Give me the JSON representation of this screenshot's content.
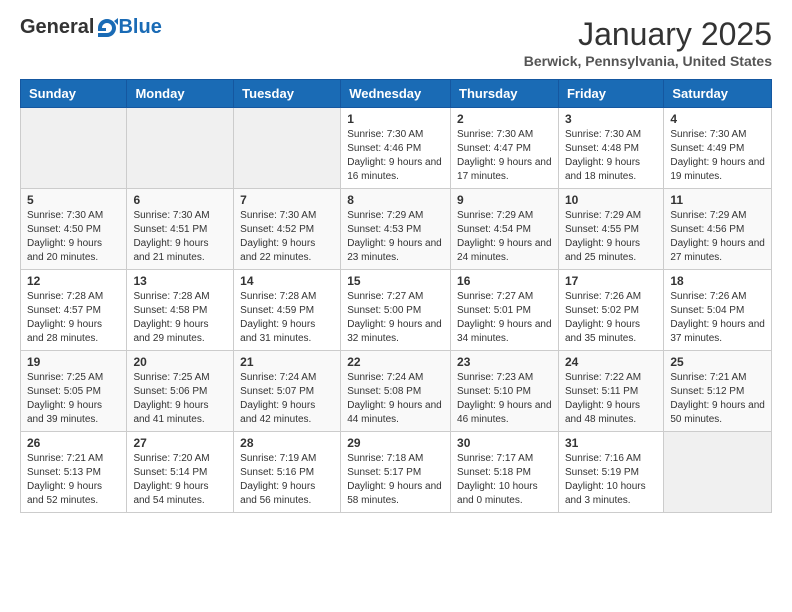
{
  "header": {
    "logo": {
      "general": "General",
      "blue": "Blue"
    },
    "title": "January 2025",
    "location": "Berwick, Pennsylvania, United States"
  },
  "days_of_week": [
    "Sunday",
    "Monday",
    "Tuesday",
    "Wednesday",
    "Thursday",
    "Friday",
    "Saturday"
  ],
  "weeks": [
    [
      {
        "day": "",
        "empty": true
      },
      {
        "day": "",
        "empty": true
      },
      {
        "day": "",
        "empty": true
      },
      {
        "day": "1",
        "sunrise": "7:30 AM",
        "sunset": "4:46 PM",
        "daylight": "9 hours and 16 minutes."
      },
      {
        "day": "2",
        "sunrise": "7:30 AM",
        "sunset": "4:47 PM",
        "daylight": "9 hours and 17 minutes."
      },
      {
        "day": "3",
        "sunrise": "7:30 AM",
        "sunset": "4:48 PM",
        "daylight": "9 hours and 18 minutes."
      },
      {
        "day": "4",
        "sunrise": "7:30 AM",
        "sunset": "4:49 PM",
        "daylight": "9 hours and 19 minutes."
      }
    ],
    [
      {
        "day": "5",
        "sunrise": "7:30 AM",
        "sunset": "4:50 PM",
        "daylight": "9 hours and 20 minutes."
      },
      {
        "day": "6",
        "sunrise": "7:30 AM",
        "sunset": "4:51 PM",
        "daylight": "9 hours and 21 minutes."
      },
      {
        "day": "7",
        "sunrise": "7:30 AM",
        "sunset": "4:52 PM",
        "daylight": "9 hours and 22 minutes."
      },
      {
        "day": "8",
        "sunrise": "7:29 AM",
        "sunset": "4:53 PM",
        "daylight": "9 hours and 23 minutes."
      },
      {
        "day": "9",
        "sunrise": "7:29 AM",
        "sunset": "4:54 PM",
        "daylight": "9 hours and 24 minutes."
      },
      {
        "day": "10",
        "sunrise": "7:29 AM",
        "sunset": "4:55 PM",
        "daylight": "9 hours and 25 minutes."
      },
      {
        "day": "11",
        "sunrise": "7:29 AM",
        "sunset": "4:56 PM",
        "daylight": "9 hours and 27 minutes."
      }
    ],
    [
      {
        "day": "12",
        "sunrise": "7:28 AM",
        "sunset": "4:57 PM",
        "daylight": "9 hours and 28 minutes."
      },
      {
        "day": "13",
        "sunrise": "7:28 AM",
        "sunset": "4:58 PM",
        "daylight": "9 hours and 29 minutes."
      },
      {
        "day": "14",
        "sunrise": "7:28 AM",
        "sunset": "4:59 PM",
        "daylight": "9 hours and 31 minutes."
      },
      {
        "day": "15",
        "sunrise": "7:27 AM",
        "sunset": "5:00 PM",
        "daylight": "9 hours and 32 minutes."
      },
      {
        "day": "16",
        "sunrise": "7:27 AM",
        "sunset": "5:01 PM",
        "daylight": "9 hours and 34 minutes."
      },
      {
        "day": "17",
        "sunrise": "7:26 AM",
        "sunset": "5:02 PM",
        "daylight": "9 hours and 35 minutes."
      },
      {
        "day": "18",
        "sunrise": "7:26 AM",
        "sunset": "5:04 PM",
        "daylight": "9 hours and 37 minutes."
      }
    ],
    [
      {
        "day": "19",
        "sunrise": "7:25 AM",
        "sunset": "5:05 PM",
        "daylight": "9 hours and 39 minutes."
      },
      {
        "day": "20",
        "sunrise": "7:25 AM",
        "sunset": "5:06 PM",
        "daylight": "9 hours and 41 minutes."
      },
      {
        "day": "21",
        "sunrise": "7:24 AM",
        "sunset": "5:07 PM",
        "daylight": "9 hours and 42 minutes."
      },
      {
        "day": "22",
        "sunrise": "7:24 AM",
        "sunset": "5:08 PM",
        "daylight": "9 hours and 44 minutes."
      },
      {
        "day": "23",
        "sunrise": "7:23 AM",
        "sunset": "5:10 PM",
        "daylight": "9 hours and 46 minutes."
      },
      {
        "day": "24",
        "sunrise": "7:22 AM",
        "sunset": "5:11 PM",
        "daylight": "9 hours and 48 minutes."
      },
      {
        "day": "25",
        "sunrise": "7:21 AM",
        "sunset": "5:12 PM",
        "daylight": "9 hours and 50 minutes."
      }
    ],
    [
      {
        "day": "26",
        "sunrise": "7:21 AM",
        "sunset": "5:13 PM",
        "daylight": "9 hours and 52 minutes."
      },
      {
        "day": "27",
        "sunrise": "7:20 AM",
        "sunset": "5:14 PM",
        "daylight": "9 hours and 54 minutes."
      },
      {
        "day": "28",
        "sunrise": "7:19 AM",
        "sunset": "5:16 PM",
        "daylight": "9 hours and 56 minutes."
      },
      {
        "day": "29",
        "sunrise": "7:18 AM",
        "sunset": "5:17 PM",
        "daylight": "9 hours and 58 minutes."
      },
      {
        "day": "30",
        "sunrise": "7:17 AM",
        "sunset": "5:18 PM",
        "daylight": "10 hours and 0 minutes."
      },
      {
        "day": "31",
        "sunrise": "7:16 AM",
        "sunset": "5:19 PM",
        "daylight": "10 hours and 3 minutes."
      },
      {
        "day": "",
        "empty": true
      }
    ]
  ]
}
